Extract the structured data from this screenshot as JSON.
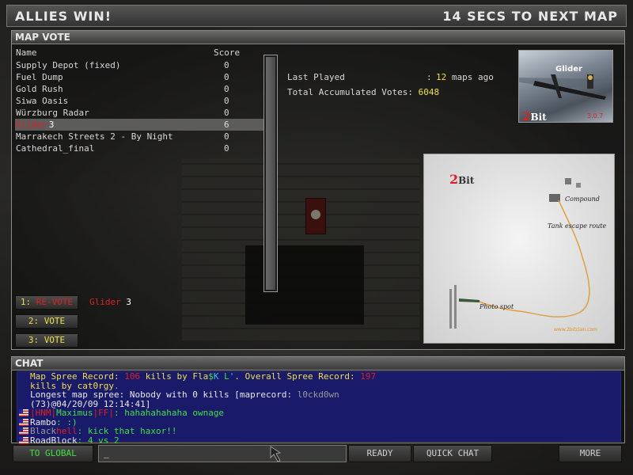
{
  "header": {
    "left": "ALLIES WIN!",
    "right": "14 SECS TO NEXT MAP"
  },
  "mapvote": {
    "title": "MAP VOTE",
    "col_name": "Name",
    "col_score": "Score",
    "maps": [
      {
        "name": "Supply Depot (fixed)",
        "score": "0"
      },
      {
        "name": "Fuel Dump",
        "score": "0"
      },
      {
        "name": "Gold Rush",
        "score": "0"
      },
      {
        "name": "Siwa Oasis",
        "score": "0"
      },
      {
        "name": "Würzburg Radar",
        "score": "0"
      },
      {
        "name": "Glider",
        "count": "3",
        "score": "6"
      },
      {
        "name": "Marrakech Streets 2 - By Night",
        "score": "0"
      },
      {
        "name": "Cathedral_final",
        "score": "0"
      }
    ],
    "last_played_label": "Last Played",
    "last_played_sep": ":",
    "last_played_value": "12",
    "last_played_unit": "maps ago",
    "total_votes_label": "Total Accumulated Votes:",
    "total_votes_value": "6048",
    "thumbnail": {
      "map_name": "Glider",
      "brand_num": "2",
      "brand_word": "Bit",
      "version": "3.0.7"
    },
    "minimap": {
      "brand_num": "2",
      "brand_word": "Bit",
      "label_compound": "Compound",
      "label_tank": "Tank escape route",
      "label_photo": "Photo spot",
      "site": "www.2bitclan.com"
    },
    "votes": [
      {
        "key": "1:",
        "label": "RE-VOTE"
      },
      {
        "key": "2:",
        "label": "VOTE"
      },
      {
        "key": "3:",
        "label": "VOTE"
      }
    ],
    "current_vote_map": "Glider",
    "current_vote_count": "3"
  },
  "chat": {
    "title": "CHAT",
    "l1": {
      "a": "Map Spree Record: ",
      "b": "106",
      "c": " kills by ",
      "d": "Fla",
      "e": "$",
      "f": "K",
      "g": " L",
      "h": "'",
      "i": ". Overall Spree Record: ",
      "j": "197"
    },
    "l2": {
      "a": "kills by cat0rgy",
      "b": "."
    },
    "l3": {
      "a": "Longest map spree: Nobody with 0 kills [maprecord: ",
      "b": "l0ckd0wn"
    },
    "l4": "(73)@04/20/09 12:14:41]",
    "l5": {
      "a": "|HNM|",
      "b": "Maximus",
      "c": "|FF|",
      "d": ": hahahahahaha ownage"
    },
    "l6": {
      "a": "Rambo",
      "b": ": :)"
    },
    "l7": {
      "a": "Black",
      "b": "hell",
      "c": ": kick that haxor!!"
    },
    "l8": {
      "a": "RoadBlock",
      "b": ": 4 vs 2"
    }
  },
  "bottom": {
    "global": "TO GLOBAL",
    "input_value": "_",
    "ready": "READY",
    "quick_chat": "QUICK CHAT",
    "more": "MORE"
  }
}
